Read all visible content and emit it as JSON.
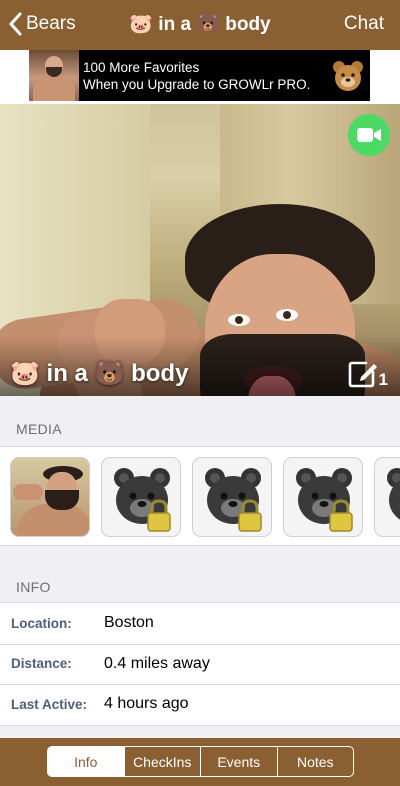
{
  "nav": {
    "back_label": "Bears",
    "title": "🐷 in a 🐻 body",
    "chat_label": "Chat"
  },
  "ad": {
    "line1": "100 More Favorites",
    "line2": "When you Upgrade to GROWLr PRO."
  },
  "profile": {
    "name": "🐷 in a 🐻 body",
    "photo_count": "1"
  },
  "media": {
    "header": "MEDIA",
    "items": [
      {
        "type": "photo",
        "locked": false
      },
      {
        "type": "private",
        "locked": true
      },
      {
        "type": "private",
        "locked": true
      },
      {
        "type": "private",
        "locked": true
      },
      {
        "type": "private",
        "locked": true
      }
    ]
  },
  "info": {
    "header": "INFO",
    "rows": [
      {
        "label": "Location:",
        "value": "Boston"
      },
      {
        "label": "Distance:",
        "value": "0.4 miles away"
      },
      {
        "label": "Last Active:",
        "value": "4 hours ago"
      }
    ]
  },
  "tabs": {
    "items": [
      "Info",
      "CheckIns",
      "Events",
      "Notes"
    ],
    "selected": "Info"
  },
  "colors": {
    "brand_brown": "#8a5f31",
    "video_green": "#4cd964",
    "label_blue": "#4c5e7f"
  }
}
